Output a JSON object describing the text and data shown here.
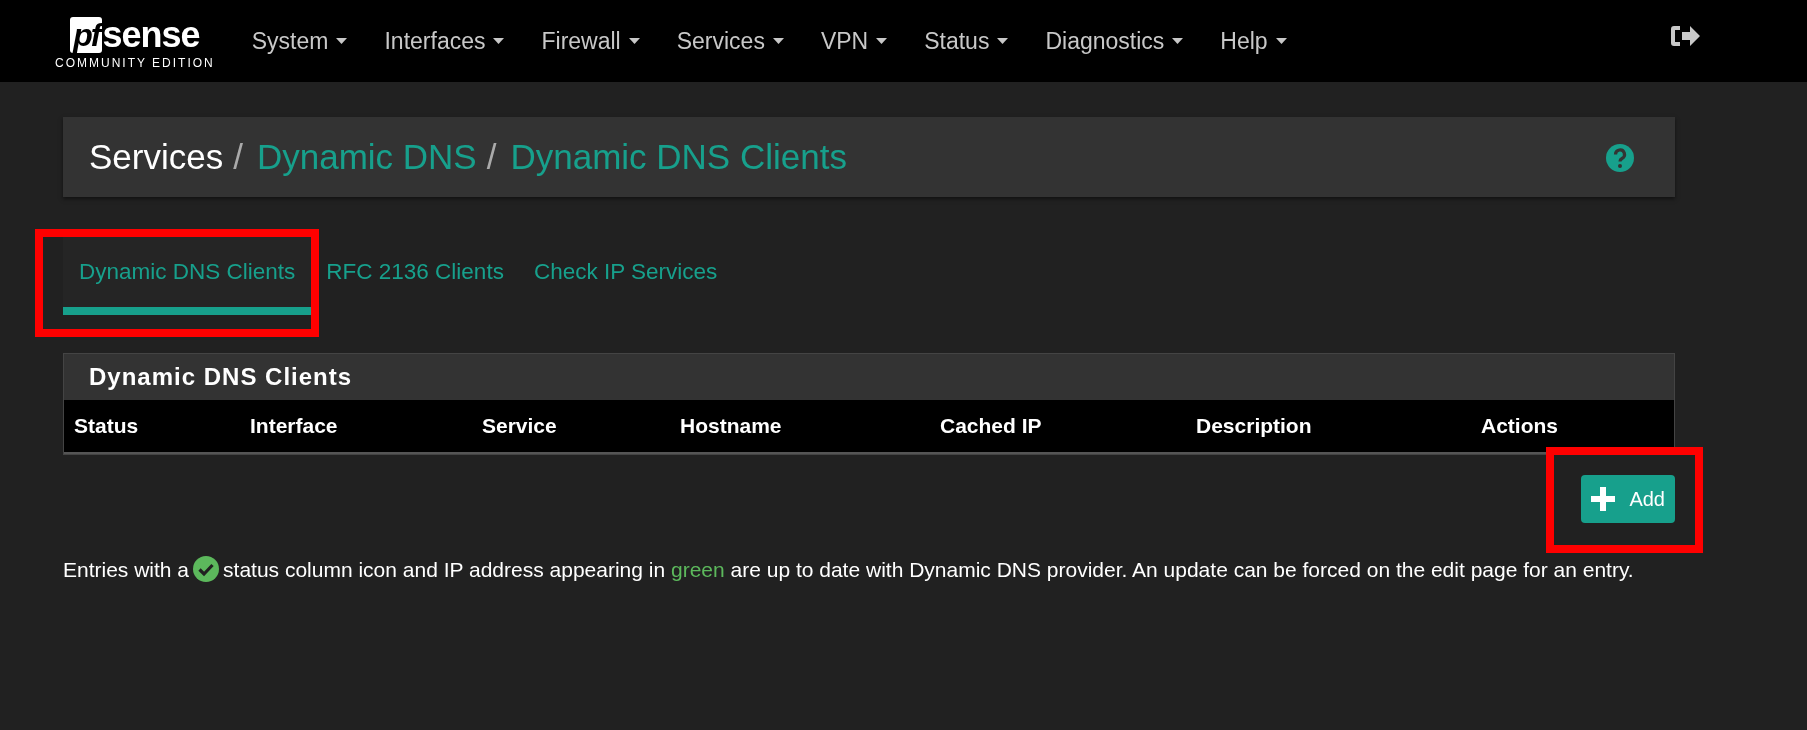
{
  "navbar": {
    "logo": {
      "brand": "sense",
      "brand_prefix": "pf",
      "edition": "COMMUNITY EDITION"
    },
    "menu": [
      {
        "label": "System"
      },
      {
        "label": "Interfaces"
      },
      {
        "label": "Firewall"
      },
      {
        "label": "Services"
      },
      {
        "label": "VPN"
      },
      {
        "label": "Status"
      },
      {
        "label": "Diagnostics"
      },
      {
        "label": "Help"
      }
    ]
  },
  "breadcrumb": [
    {
      "label": "Services",
      "link": false
    },
    {
      "separator": "/",
      "label": "Dynamic DNS",
      "link": true
    },
    {
      "separator": "/",
      "label": "Dynamic DNS Clients",
      "link": true
    }
  ],
  "tabs": [
    {
      "label": "Dynamic DNS Clients",
      "selected": true,
      "highlighted": true
    },
    {
      "label": "RFC 2136 Clients",
      "selected": false,
      "highlighted": false
    },
    {
      "label": "Check IP Services",
      "selected": false,
      "highlighted": false
    }
  ],
  "panel": {
    "title": "Dynamic DNS Clients",
    "columns": [
      "Status",
      "Interface",
      "Service",
      "Hostname",
      "Cached IP",
      "Description",
      "Actions"
    ]
  },
  "add_button": {
    "label": "Add",
    "highlighted": true
  },
  "help_text": {
    "before": "Entries with a",
    "middle": "status column icon and IP address appearing in",
    "green_word": "green",
    "after": "are up to date with Dynamic DNS provider. An update can be forced on the edit page for an entry."
  }
}
